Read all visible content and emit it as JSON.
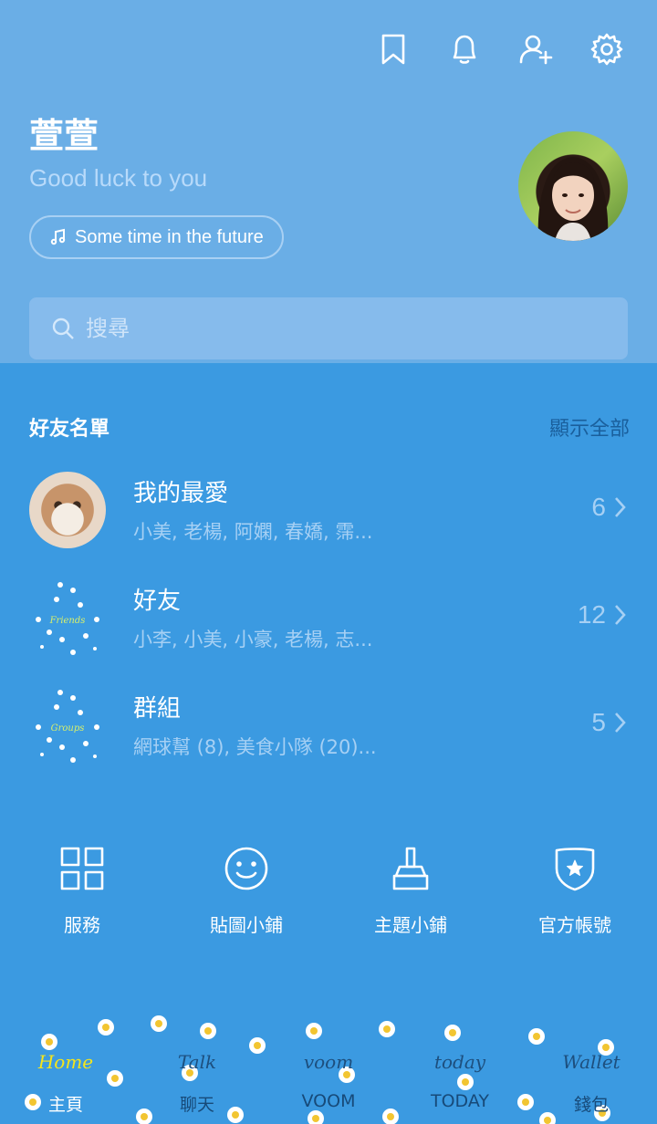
{
  "top_icons": [
    "bookmark-icon",
    "bell-icon",
    "add-friend-icon",
    "gear-icon"
  ],
  "profile": {
    "name": "萱萱",
    "status": "Good luck to you",
    "music": "Some time in the future"
  },
  "search": {
    "placeholder": "搜尋"
  },
  "friends_section": {
    "title": "好友名單",
    "show_all": "顯示全部",
    "rows": [
      {
        "title": "我的最愛",
        "subtitle": "小美, 老楊, 阿嫻, 春嬌, 霈...",
        "count": "6"
      },
      {
        "title": "好友",
        "subtitle": "小李, 小美, 小豪, 老楊, 志...",
        "count": "12",
        "thumb_text": "Friends"
      },
      {
        "title": "群組",
        "subtitle": "網球幫 (8), 美食小隊 (20)...",
        "count": "5",
        "thumb_text": "Groups"
      }
    ]
  },
  "services": [
    {
      "label": "服務",
      "icon": "grid-icon"
    },
    {
      "label": "貼圖小鋪",
      "icon": "smiley-icon"
    },
    {
      "label": "主題小鋪",
      "icon": "brush-icon"
    },
    {
      "label": "官方帳號",
      "icon": "shield-star-icon"
    }
  ],
  "bottom_tabs": [
    {
      "script": "Home",
      "label": "主頁",
      "active": true
    },
    {
      "script": "Talk",
      "label": "聊天",
      "active": false
    },
    {
      "script": "voom",
      "label": "VOOM",
      "active": false
    },
    {
      "script": "today",
      "label": "TODAY",
      "active": false
    },
    {
      "script": "Wallet",
      "label": "錢包",
      "active": false
    }
  ],
  "colors": {
    "header_bg": "#6aaee6",
    "body_bg": "#3b9ae1",
    "active_tab": "#f5e51b"
  }
}
